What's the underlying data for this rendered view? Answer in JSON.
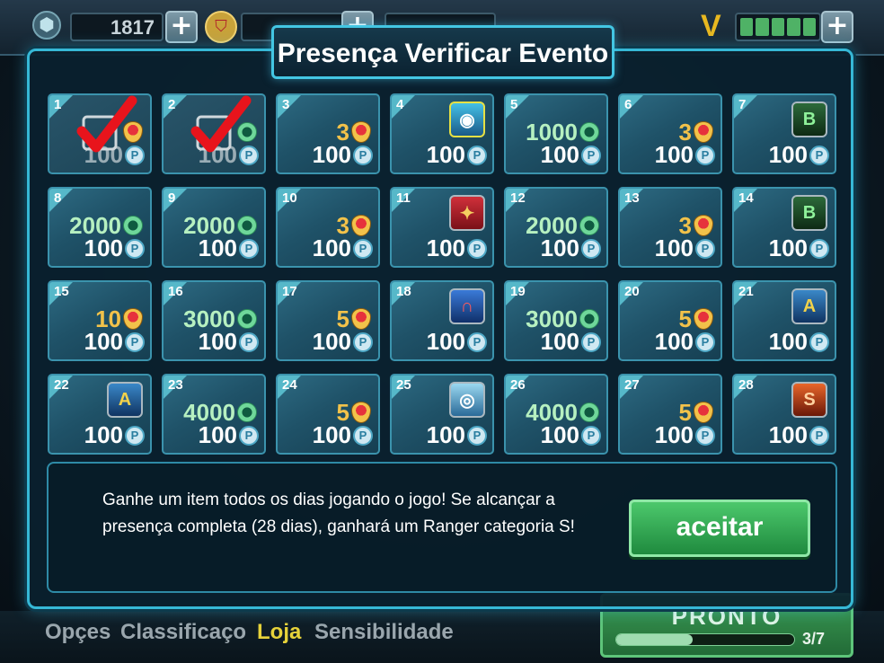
{
  "hud": {
    "gold": "1817",
    "gem_icon": "gem-icon",
    "badge_icon": "shield-badge-icon",
    "energy_letter": "V",
    "energy_segments": 5
  },
  "dialog": {
    "title": "Presença Verificar Evento",
    "info_text": "Ganhe um item todos os dias jogando o jogo! Se alcançar a presença completa (28 dias), ganhará um Ranger categoria S!",
    "accept_label": "aceitar"
  },
  "coin_symbol": "P",
  "days": [
    {
      "num": "1",
      "type": "shield",
      "value": "",
      "bonus": "100",
      "claimed": true
    },
    {
      "num": "2",
      "type": "gem",
      "value": "",
      "bonus": "100",
      "claimed": true
    },
    {
      "num": "3",
      "type": "shield",
      "value": "3",
      "bonus": "100"
    },
    {
      "num": "4",
      "type": "char",
      "char": "robot",
      "bonus": "100"
    },
    {
      "num": "5",
      "type": "gem",
      "value": "1000",
      "bonus": "100"
    },
    {
      "num": "6",
      "type": "shield",
      "value": "3",
      "bonus": "100"
    },
    {
      "num": "7",
      "type": "char",
      "char": "B",
      "bonus": "100"
    },
    {
      "num": "8",
      "type": "gem",
      "value": "2000",
      "bonus": "100"
    },
    {
      "num": "9",
      "type": "gem",
      "value": "2000",
      "bonus": "100"
    },
    {
      "num": "10",
      "type": "shield",
      "value": "3",
      "bonus": "100"
    },
    {
      "num": "11",
      "type": "char",
      "char": "medal",
      "bonus": "100"
    },
    {
      "num": "12",
      "type": "gem",
      "value": "2000",
      "bonus": "100"
    },
    {
      "num": "13",
      "type": "shield",
      "value": "3",
      "bonus": "100"
    },
    {
      "num": "14",
      "type": "char",
      "char": "B",
      "bonus": "100"
    },
    {
      "num": "15",
      "type": "shield",
      "value": "10",
      "bonus": "100"
    },
    {
      "num": "16",
      "type": "gem",
      "value": "3000",
      "bonus": "100"
    },
    {
      "num": "17",
      "type": "shield",
      "value": "5",
      "bonus": "100"
    },
    {
      "num": "18",
      "type": "char",
      "char": "magnet",
      "bonus": "100"
    },
    {
      "num": "19",
      "type": "gem",
      "value": "3000",
      "bonus": "100"
    },
    {
      "num": "20",
      "type": "shield",
      "value": "5",
      "bonus": "100"
    },
    {
      "num": "21",
      "type": "char",
      "char": "A",
      "bonus": "100"
    },
    {
      "num": "22",
      "type": "char",
      "char": "A",
      "bonus": "100"
    },
    {
      "num": "23",
      "type": "gem",
      "value": "4000",
      "bonus": "100"
    },
    {
      "num": "24",
      "type": "shield",
      "value": "5",
      "bonus": "100"
    },
    {
      "num": "25",
      "type": "char",
      "char": "pad",
      "bonus": "100"
    },
    {
      "num": "26",
      "type": "gem",
      "value": "4000",
      "bonus": "100"
    },
    {
      "num": "27",
      "type": "shield",
      "value": "5",
      "bonus": "100"
    },
    {
      "num": "28",
      "type": "char",
      "char": "S",
      "bonus": "100"
    }
  ],
  "bottom_menu": [
    {
      "label": "Opçes",
      "active": false
    },
    {
      "label": "Classificaço",
      "active": false
    },
    {
      "label": "Loja",
      "active": true
    },
    {
      "label": "Sensibilidade",
      "active": false
    }
  ],
  "ready": {
    "label": "PRONTO",
    "count": "3/7",
    "progress": 0.43
  },
  "colors": {
    "accent": "#36b8d6",
    "accept": "#1f8a3e",
    "shield_value": "#f2c24a",
    "gem_value": "#b6f0c0"
  }
}
